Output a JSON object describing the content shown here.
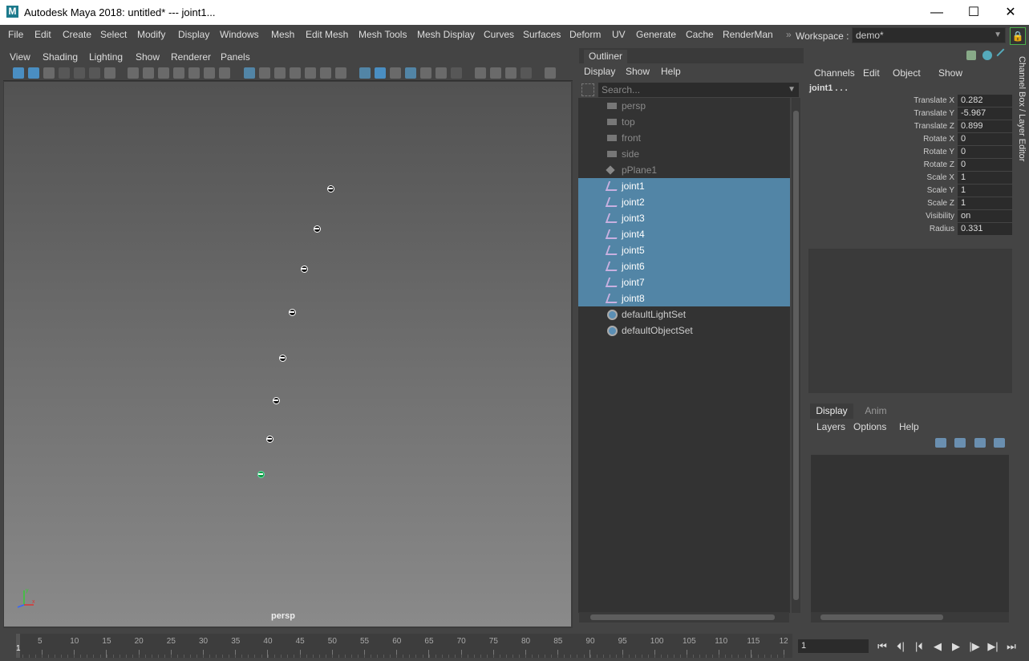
{
  "window": {
    "logo": "M",
    "title": "Autodesk Maya 2018: untitled*   ---   joint1...",
    "minimize": "—",
    "maximize": "☐",
    "close": "✕"
  },
  "menubar": [
    "File",
    "Edit",
    "Create",
    "Select",
    "Modify",
    "Display",
    "Windows",
    "Mesh",
    "Edit Mesh",
    "Mesh Tools",
    "Mesh Display",
    "Curves",
    "Surfaces",
    "Deform",
    "UV",
    "Generate",
    "Cache",
    "RenderMan"
  ],
  "workspace": {
    "label": "Workspace :",
    "value": "demo*",
    "lock_icon": "lock-icon"
  },
  "viewport": {
    "menu": [
      "View",
      "Shading",
      "Lighting",
      "Show",
      "Renderer",
      "Panels"
    ],
    "camera_label": "persp",
    "axis": {
      "x": "x",
      "y": "y"
    },
    "joints": [
      "joint1",
      "joint2",
      "joint3",
      "joint4",
      "joint5",
      "joint6",
      "joint7",
      "joint8"
    ]
  },
  "outliner": {
    "tab": "Outliner",
    "menu": [
      "Display",
      "Show",
      "Help"
    ],
    "search_placeholder": "Search...",
    "items": [
      {
        "label": "persp",
        "icon": "camera-icon",
        "state": "dim"
      },
      {
        "label": "top",
        "icon": "camera-icon",
        "state": "dim"
      },
      {
        "label": "front",
        "icon": "camera-icon",
        "state": "dim"
      },
      {
        "label": "side",
        "icon": "camera-icon",
        "state": "dim"
      },
      {
        "label": "pPlane1",
        "icon": "mesh-icon",
        "state": "dim"
      },
      {
        "label": "joint1",
        "icon": "joint-icon",
        "state": "selected"
      },
      {
        "label": "joint2",
        "icon": "joint-icon",
        "state": "selected"
      },
      {
        "label": "joint3",
        "icon": "joint-icon",
        "state": "selected"
      },
      {
        "label": "joint4",
        "icon": "joint-icon",
        "state": "selected"
      },
      {
        "label": "joint5",
        "icon": "joint-icon",
        "state": "selected"
      },
      {
        "label": "joint6",
        "icon": "joint-icon",
        "state": "selected"
      },
      {
        "label": "joint7",
        "icon": "joint-icon",
        "state": "selected"
      },
      {
        "label": "joint8",
        "icon": "joint-icon",
        "state": "selected"
      },
      {
        "label": "defaultLightSet",
        "icon": "set-icon",
        "state": "normal"
      },
      {
        "label": "defaultObjectSet",
        "icon": "set-icon",
        "state": "normal"
      }
    ]
  },
  "channel_box": {
    "menu": [
      "Channels",
      "Edit",
      "Object",
      "Show"
    ],
    "node": "joint1  . . .",
    "attributes": [
      {
        "name": "Translate X",
        "value": "0.282"
      },
      {
        "name": "Translate Y",
        "value": "-5.967"
      },
      {
        "name": "Translate Z",
        "value": "0.899"
      },
      {
        "name": "Rotate X",
        "value": "0"
      },
      {
        "name": "Rotate Y",
        "value": "0"
      },
      {
        "name": "Rotate Z",
        "value": "0"
      },
      {
        "name": "Scale X",
        "value": "1"
      },
      {
        "name": "Scale Y",
        "value": "1"
      },
      {
        "name": "Scale Z",
        "value": "1"
      },
      {
        "name": "Visibility",
        "value": "on"
      },
      {
        "name": "Radius",
        "value": "0.331"
      }
    ],
    "side_tab": "Channel Box / Layer Editor"
  },
  "layer_editor": {
    "tabs": [
      "Display",
      "Anim"
    ],
    "menu": [
      "Layers",
      "Options",
      "Help"
    ]
  },
  "timeline": {
    "ticks": [
      "5",
      "10",
      "15",
      "20",
      "25",
      "30",
      "35",
      "40",
      "45",
      "50",
      "55",
      "60",
      "65",
      "70",
      "75",
      "80",
      "85",
      "90",
      "95",
      "100",
      "105",
      "110",
      "115",
      "12"
    ],
    "current_frame": "1",
    "frame_field": "1",
    "playback": [
      "⏮",
      "⏴|",
      "|⏴",
      "◀",
      "▶",
      "|▶",
      "▶|",
      "⏭"
    ]
  }
}
